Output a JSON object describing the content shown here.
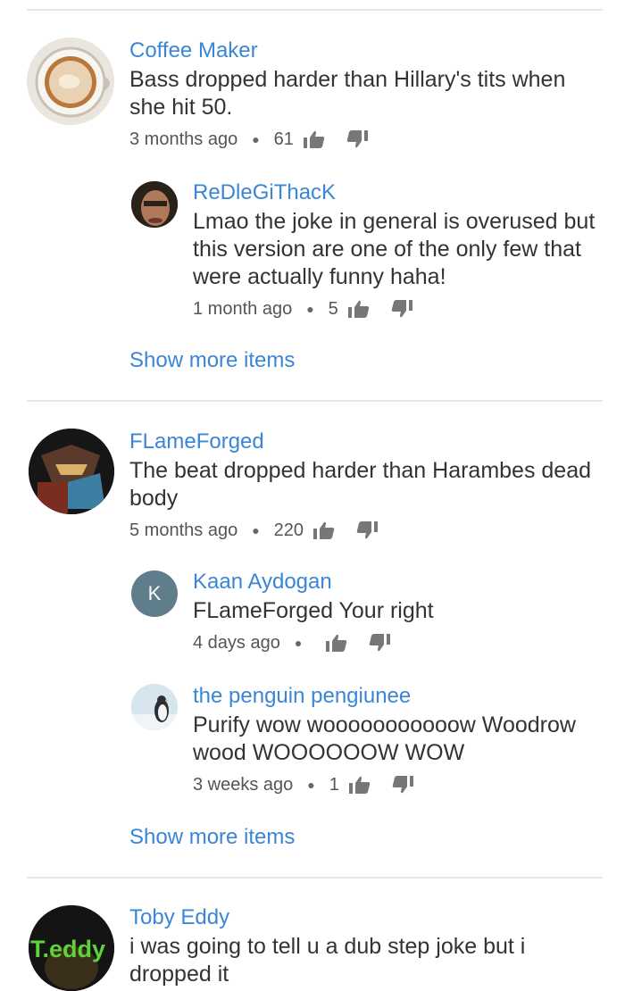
{
  "threads": [
    {
      "author": "Coffee Maker",
      "text": "Bass dropped harder than Hillary's tits when she hit 50.",
      "time": "3 months ago",
      "likes": "61",
      "replies": [
        {
          "author": "ReDleGiThacK",
          "text": "Lmao the joke in general is overused but this version are one of the only few that were actually funny haha!",
          "time": "1 month ago",
          "likes": "5"
        }
      ],
      "show_more": "Show more items"
    },
    {
      "author": "FLameForged",
      "text": "The beat dropped harder than Harambes dead body",
      "time": "5 months ago",
      "likes": "220",
      "replies": [
        {
          "author": "Kaan Aydogan",
          "avatar_letter": "K",
          "text": "FLameForged Your right",
          "time": "4 days ago",
          "likes": ""
        },
        {
          "author": "the penguin pengiunee",
          "text": "Purify wow wooooooooooow Woodrow wood WOOOOOOW WOW",
          "time": "3 weeks ago",
          "likes": "1"
        }
      ],
      "show_more": "Show more items"
    },
    {
      "author": "Toby Eddy",
      "avatar_text": "T.eddy",
      "text": "i was going to tell u a dub step joke but i dropped it"
    }
  ],
  "colors": {
    "link": "#3a86d6",
    "text": "#333333",
    "meta": "#555555",
    "divider": "#e6e6e6"
  }
}
